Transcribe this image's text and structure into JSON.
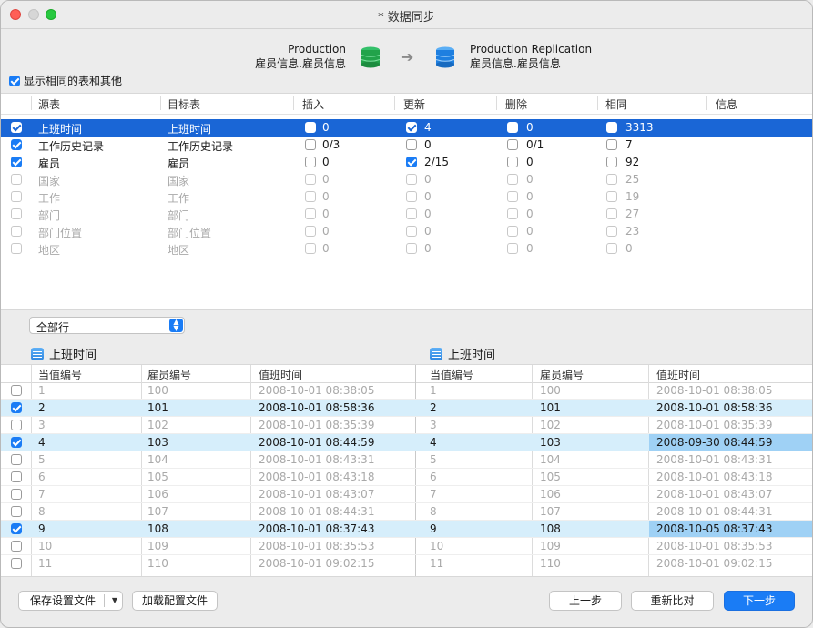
{
  "window": {
    "title": "* 数据同步"
  },
  "header": {
    "source": {
      "server": "Production",
      "schema": "雇员信息.雇员信息"
    },
    "target": {
      "server": "Production Replication",
      "schema": "雇员信息.雇员信息"
    },
    "source_color": "#22a34a",
    "target_color": "#1e7fe0"
  },
  "show_same": {
    "label": "显示相同的表和其他",
    "checked": true
  },
  "table1": {
    "columns": [
      "源表",
      "目标表",
      "插入",
      "更新",
      "删除",
      "相同",
      "信息"
    ],
    "rows": [
      {
        "checked": true,
        "src": "上班时间",
        "tgt": "上班时间",
        "ins_chk": false,
        "ins": "0",
        "upd_chk": true,
        "upd": "4",
        "del_chk": false,
        "del": "0",
        "same_chk": false,
        "same": "3313",
        "selected": true,
        "enabled": true
      },
      {
        "checked": true,
        "src": "工作历史记录",
        "tgt": "工作历史记录",
        "ins_chk": false,
        "ins": "0/3",
        "upd_chk": false,
        "upd": "0",
        "del_chk": false,
        "del": "0/1",
        "same_chk": false,
        "same": "7",
        "selected": false,
        "enabled": true
      },
      {
        "checked": true,
        "src": "雇员",
        "tgt": "雇员",
        "ins_chk": false,
        "ins": "0",
        "upd_chk": true,
        "upd": "2/15",
        "del_chk": false,
        "del": "0",
        "same_chk": false,
        "same": "92",
        "selected": false,
        "enabled": true
      },
      {
        "checked": false,
        "src": "国家",
        "tgt": "国家",
        "ins_chk": false,
        "ins": "0",
        "upd_chk": false,
        "upd": "0",
        "del_chk": false,
        "del": "0",
        "same_chk": false,
        "same": "25",
        "selected": false,
        "enabled": false
      },
      {
        "checked": false,
        "src": "工作",
        "tgt": "工作",
        "ins_chk": false,
        "ins": "0",
        "upd_chk": false,
        "upd": "0",
        "del_chk": false,
        "del": "0",
        "same_chk": false,
        "same": "19",
        "selected": false,
        "enabled": false
      },
      {
        "checked": false,
        "src": "部门",
        "tgt": "部门",
        "ins_chk": false,
        "ins": "0",
        "upd_chk": false,
        "upd": "0",
        "del_chk": false,
        "del": "0",
        "same_chk": false,
        "same": "27",
        "selected": false,
        "enabled": false
      },
      {
        "checked": false,
        "src": "部门位置",
        "tgt": "部门位置",
        "ins_chk": false,
        "ins": "0",
        "upd_chk": false,
        "upd": "0",
        "del_chk": false,
        "del": "0",
        "same_chk": false,
        "same": "23",
        "selected": false,
        "enabled": false
      },
      {
        "checked": false,
        "src": "地区",
        "tgt": "地区",
        "ins_chk": false,
        "ins": "0",
        "upd_chk": false,
        "upd": "0",
        "del_chk": false,
        "del": "0",
        "same_chk": false,
        "same": "0",
        "selected": false,
        "enabled": false
      }
    ]
  },
  "filter": {
    "value": "全部行"
  },
  "detail": {
    "left_title": "上班时间",
    "right_title": "上班时间",
    "columns": [
      "当值编号",
      "雇员编号",
      "值班时间",
      "当值编号",
      "雇员编号",
      "值班时间"
    ],
    "rows": [
      {
        "checked": false,
        "diff": false,
        "l1": "1",
        "l2": "100",
        "l3": "2008-10-01 08:38:05",
        "r1": "1",
        "r2": "100",
        "r3": "2008-10-01 08:38:05"
      },
      {
        "checked": true,
        "diff": true,
        "l1": "2",
        "l2": "101",
        "l3": "2008-10-01 08:58:36",
        "r1": "2",
        "r2": "101",
        "r3": "2008-10-01 08:58:36",
        "hl": false
      },
      {
        "checked": false,
        "diff": false,
        "l1": "3",
        "l2": "102",
        "l3": "2008-10-01 08:35:39",
        "r1": "3",
        "r2": "102",
        "r3": "2008-10-01 08:35:39"
      },
      {
        "checked": true,
        "diff": true,
        "l1": "4",
        "l2": "103",
        "l3": "2008-10-01 08:44:59",
        "r1": "4",
        "r2": "103",
        "r3": "2008-09-30 08:44:59",
        "hl": true
      },
      {
        "checked": false,
        "diff": false,
        "l1": "5",
        "l2": "104",
        "l3": "2008-10-01 08:43:31",
        "r1": "5",
        "r2": "104",
        "r3": "2008-10-01 08:43:31"
      },
      {
        "checked": false,
        "diff": false,
        "l1": "6",
        "l2": "105",
        "l3": "2008-10-01 08:43:18",
        "r1": "6",
        "r2": "105",
        "r3": "2008-10-01 08:43:18"
      },
      {
        "checked": false,
        "diff": false,
        "l1": "7",
        "l2": "106",
        "l3": "2008-10-01 08:43:07",
        "r1": "7",
        "r2": "106",
        "r3": "2008-10-01 08:43:07"
      },
      {
        "checked": false,
        "diff": false,
        "l1": "8",
        "l2": "107",
        "l3": "2008-10-01 08:44:31",
        "r1": "8",
        "r2": "107",
        "r3": "2008-10-01 08:44:31"
      },
      {
        "checked": true,
        "diff": true,
        "l1": "9",
        "l2": "108",
        "l3": "2008-10-01 08:37:43",
        "r1": "9",
        "r2": "108",
        "r3": "2008-10-05 08:37:43",
        "hl": true
      },
      {
        "checked": false,
        "diff": false,
        "l1": "10",
        "l2": "109",
        "l3": "2008-10-01 08:35:53",
        "r1": "10",
        "r2": "109",
        "r3": "2008-10-01 08:35:53"
      },
      {
        "checked": false,
        "diff": false,
        "l1": "11",
        "l2": "110",
        "l3": "2008-10-01 09:02:15",
        "r1": "11",
        "r2": "110",
        "r3": "2008-10-01 09:02:15"
      }
    ]
  },
  "footer": {
    "save_label": "保存设置文件",
    "load_label": "加载配置文件",
    "prev_label": "上一步",
    "recompare_label": "重新比对",
    "next_label": "下一步"
  }
}
